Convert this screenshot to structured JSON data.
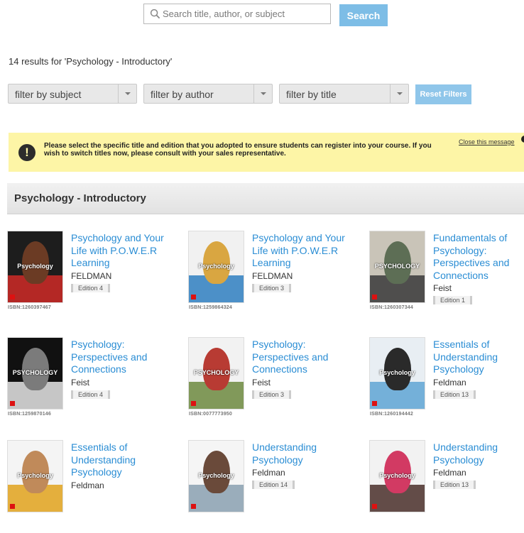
{
  "search": {
    "placeholder": "Search title, author, or subject",
    "button_label": "Search"
  },
  "results": {
    "count_text": "14 results for 'Psychology - Introductory'"
  },
  "filters": {
    "subject": "filter by subject",
    "author": "filter by author",
    "title": "filter by title",
    "reset_label": "Reset Filters"
  },
  "notice": {
    "text": "Please select the specific title and edition that you adopted to ensure students can register into your course. If you wish to switch titles now, please consult with your sales representative.",
    "close_label": "Close this message"
  },
  "section": {
    "title": "Psychology - Introductory"
  },
  "books": [
    {
      "title": "Psychology and Your Life with P.O.W.E.R Learning",
      "author": "FELDMAN",
      "edition": "Edition 4",
      "isbn": "ISBN:1260397467"
    },
    {
      "title": "Psychology and Your Life with P.O.W.E.R Learning",
      "author": "FELDMAN",
      "edition": "Edition 3",
      "isbn": "ISBN:1259864324"
    },
    {
      "title": "Fundamentals of Psychology: Perspectives and Connections",
      "author": "Feist",
      "edition": "Edition 1",
      "isbn": "ISBN:1260307344"
    },
    {
      "title": "Psychology: Perspectives and Connections",
      "author": "Feist",
      "edition": "Edition 4",
      "isbn": "ISBN:1259870146"
    },
    {
      "title": "Psychology: Perspectives and Connections",
      "author": "Feist",
      "edition": "Edition 3",
      "isbn": "ISBN:0077773950"
    },
    {
      "title": "Essentials of Understanding Psychology",
      "author": "Feldman",
      "edition": "Edition 13",
      "isbn": "ISBN:1260194442"
    },
    {
      "title": "Essentials of Understanding Psychology",
      "author": "Feldman",
      "edition": "",
      "isbn": ""
    },
    {
      "title": "Understanding Psychology",
      "author": "Feldman",
      "edition": "Edition 14",
      "isbn": ""
    },
    {
      "title": "Understanding Psychology",
      "author": "Feldman",
      "edition": "Edition 13",
      "isbn": ""
    }
  ],
  "covers": [
    {
      "word": "Psychology",
      "colors": [
        "#1d1d1d",
        "#6b3b24",
        "#cf2a27"
      ]
    },
    {
      "word": "Psychology",
      "colors": [
        "#f1f1f1",
        "#d9a641",
        "#2f7fc1"
      ]
    },
    {
      "word": "PSYCHOLOGY",
      "colors": [
        "#c9c4b8",
        "#5d6e55",
        "#3a3a3a"
      ]
    },
    {
      "word": "PSYCHOLOGY",
      "colors": [
        "#111111",
        "#7b7b7b",
        "#e6e6e6"
      ]
    },
    {
      "word": "PSYCHOLOGY",
      "colors": [
        "#f2f2f2",
        "#b83b33",
        "#6d8a3f"
      ]
    },
    {
      "word": "Psychology",
      "colors": [
        "#e8eef3",
        "#2a2a2a",
        "#5fa4d4"
      ]
    },
    {
      "word": "Psychology",
      "colors": [
        "#f4f4f4",
        "#c08a5a",
        "#e0a21c"
      ]
    },
    {
      "word": "Psychology",
      "colors": [
        "#f5f5f5",
        "#6a4a3a",
        "#8aa0b0"
      ]
    },
    {
      "word": "Psychology",
      "colors": [
        "#f2f2f2",
        "#d23a63",
        "#4a2f2a"
      ]
    }
  ],
  "colors": {
    "link": "#2a8dd4",
    "search_button": "#7dbde6",
    "reset_button": "#8fc6ea",
    "notice_bg": "#fdf5a6"
  }
}
